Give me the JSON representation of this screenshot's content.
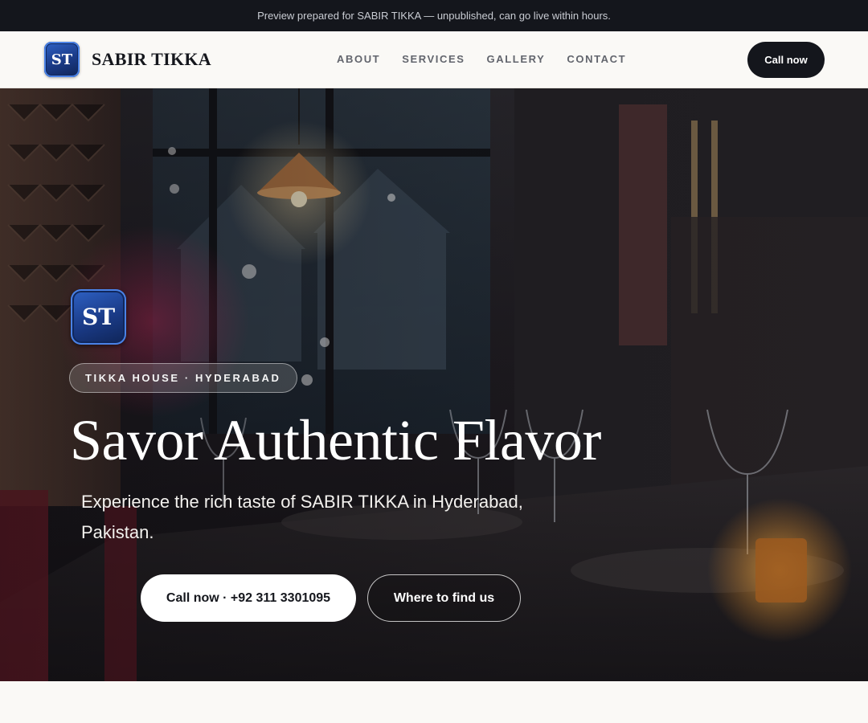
{
  "preview_bar": {
    "text": "Preview prepared for SABIR TIKKA — unpublished, can go live within hours."
  },
  "header": {
    "logo_initials": "ST",
    "brand_name": "SABIR TIKKA",
    "nav": [
      {
        "label": "ABOUT"
      },
      {
        "label": "SERVICES"
      },
      {
        "label": "GALLERY"
      },
      {
        "label": "CONTACT"
      }
    ],
    "call_button": "Call now"
  },
  "hero": {
    "logo_initials": "ST",
    "tag": "TIKKA HOUSE · HYDERABAD",
    "title": "Savor Authentic Flavor",
    "subtitle": "Experience the rich taste of SABIR TIKKA in Hyderabad, Pakistan.",
    "primary_button": "Call now · +92 311 3301095",
    "secondary_button": "Where to find us",
    "background_description_icon": "restaurant-interior-photo"
  },
  "colors": {
    "dark": "#14161c",
    "page_background": "#faf9f6",
    "logo_blue": "#1a3a86",
    "nav_text": "#62656d"
  }
}
